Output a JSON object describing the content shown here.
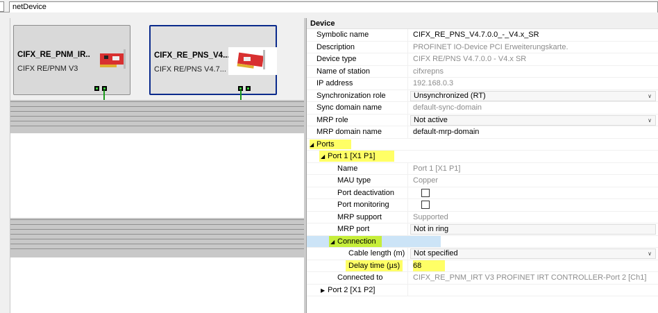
{
  "tab": {
    "title": "netDevice"
  },
  "devices": [
    {
      "name": "CIFX_RE_PNM_IR..",
      "subtitle": "CIFX RE/PNM V3"
    },
    {
      "name": "CIFX_RE_PNS_V4...",
      "subtitle": "CIFX RE/PNS V4.7..."
    }
  ],
  "properties": {
    "group": "Device",
    "rows": [
      {
        "label": "Symbolic name",
        "value": "CIFX_RE_PNS_V4.7.0.0_-_V4.x_SR"
      },
      {
        "label": "Description",
        "value": "PROFINET IO-Device PCI Erweiterungskarte."
      },
      {
        "label": "Device type",
        "value": "CIFX RE/PNS V4.7.0.0 - V4.x SR"
      },
      {
        "label": "Name of station",
        "value": "cifxrepns"
      },
      {
        "label": "IP address",
        "value": "192.168.0.3"
      },
      {
        "label": "Synchronization role",
        "value": "Unsynchronized (RT)"
      },
      {
        "label": "Sync domain name",
        "value": "default-sync-domain"
      },
      {
        "label": "MRP role",
        "value": "Not active"
      },
      {
        "label": "MRP domain name",
        "value": "default-mrp-domain"
      },
      {
        "label": "Ports",
        "value": ""
      },
      {
        "label": "Port 1 [X1 P1]",
        "value": ""
      },
      {
        "label": "Name",
        "value": "Port 1 [X1 P1]"
      },
      {
        "label": "MAU type",
        "value": "Copper"
      },
      {
        "label": "Port deactivation",
        "value": ""
      },
      {
        "label": "Port monitoring",
        "value": ""
      },
      {
        "label": "MRP support",
        "value": "Supported"
      },
      {
        "label": "MRP port",
        "value": "Not in ring"
      },
      {
        "label": "Connection",
        "value": ""
      },
      {
        "label": "Cable length (m)",
        "value": "Not specified"
      },
      {
        "label": "Delay time (µs)",
        "value": "68"
      },
      {
        "label": "Connected to",
        "value": "CIFX_RE_PNM_IRT V3 PROFINET IRT CONTROLLER-Port 2 [Ch1]"
      },
      {
        "label": "Port 2 [X1 P2]",
        "value": ""
      }
    ]
  },
  "colors": {
    "highlight": "#ffff66",
    "connection_highlight": "#c6ee3a",
    "link_line": "#1a9a1a",
    "selected_border": "#0a2a8c"
  }
}
